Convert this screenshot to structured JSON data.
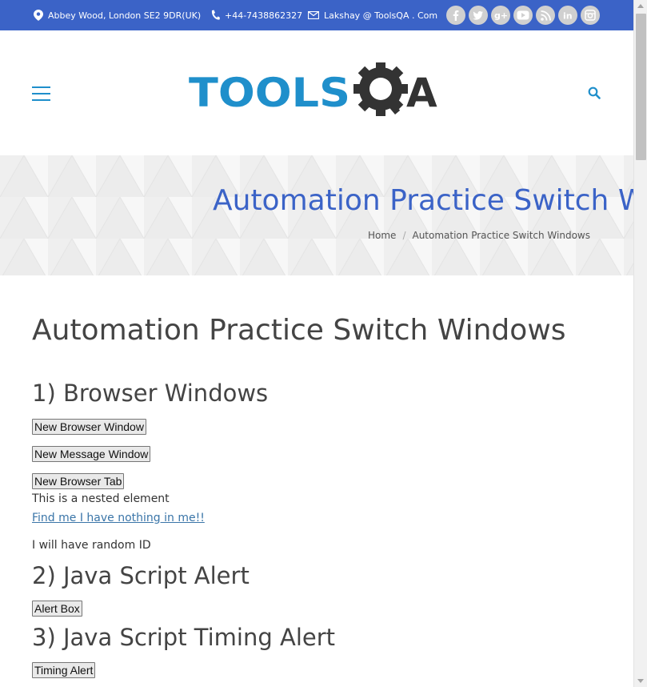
{
  "topbar": {
    "address": "Abbey Wood, London SE2 9DR(UK)",
    "phone": "+44-7438862327",
    "email": "Lakshay @ ToolsQA . Com",
    "socials": [
      {
        "icon": "facebook-icon",
        "glyph": "f"
      },
      {
        "icon": "twitter-icon",
        "glyph": "t"
      },
      {
        "icon": "google-plus-icon",
        "glyph": "g+"
      },
      {
        "icon": "youtube-icon",
        "glyph": "▶"
      },
      {
        "icon": "rss-icon",
        "glyph": "rss"
      },
      {
        "icon": "linkedin-icon",
        "glyph": "in"
      },
      {
        "icon": "instagram-icon",
        "glyph": "ig"
      }
    ],
    "color": "#3b63c7"
  },
  "header": {
    "logo_text_tools": "TOOLS",
    "logo_text_qa": "QA",
    "logo_blue": "#1f8fcb",
    "logo_dark": "#333333"
  },
  "banner": {
    "title": "Automation Practice Switch Windows",
    "breadcrumb_home": "Home",
    "breadcrumb_sep": "/",
    "breadcrumb_current": "Automation Practice Switch Windows"
  },
  "content": {
    "page_title": "Automation Practice Switch Windows",
    "section1_title": "1) Browser Windows",
    "btn_new_window": "New Browser Window",
    "btn_new_message": "New Message Window",
    "btn_new_tab": "New Browser Tab",
    "nested_text": "This is a nested element",
    "link_text": "Find me I have nothing in me!!",
    "random_id_text": "I will have random ID",
    "section2_title": "2) Java Script Alert",
    "btn_alert": "Alert Box",
    "section3_title": "3) Java Script Timing Alert",
    "btn_timing": "Timing Alert"
  }
}
